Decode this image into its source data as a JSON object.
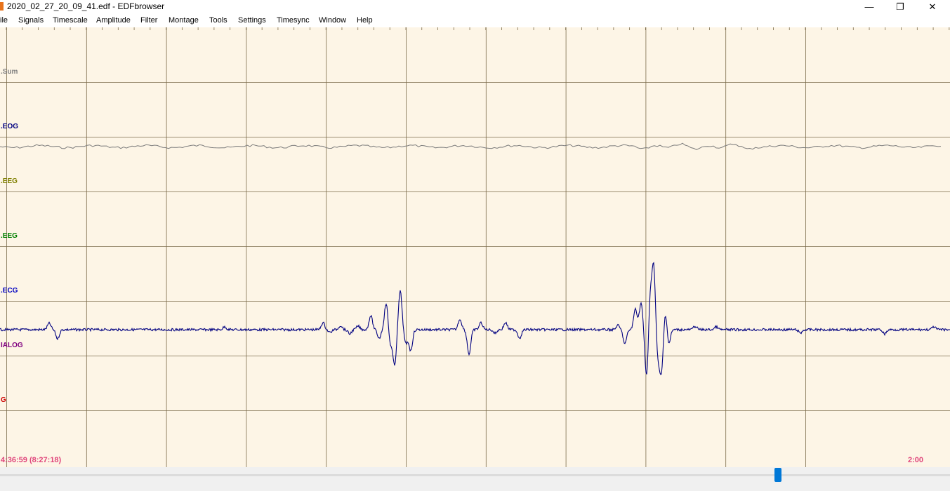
{
  "window": {
    "title": "2020_02_27_20_09_41.edf - EDFbrowser",
    "minimize_glyph": "—",
    "restore_glyph": "❐",
    "close_glyph": "✕"
  },
  "menu": {
    "items": [
      "ile",
      "Signals",
      "Timescale",
      "Amplitude",
      "Filter",
      "Montage",
      "Tools",
      "Settings",
      "Timesync",
      "Window",
      "Help"
    ]
  },
  "signals": [
    {
      "label": ".Sum",
      "color": "#808080"
    },
    {
      "label": ".EOG",
      "color": "#000080"
    },
    {
      "label": ".EEG",
      "color": "#808000"
    },
    {
      "label": ".EEG",
      "color": "#008000"
    },
    {
      "label": ".ECG",
      "color": "#0000c0"
    },
    {
      "label": "IALOG",
      "color": "#800080"
    },
    {
      "label": "G",
      "color": "#cc0000"
    }
  ],
  "footer": {
    "start_time": "4:36:59 (8:27:18)",
    "end_time": "2:00"
  },
  "colors": {
    "plot_background": "#fdf5e6",
    "grid": "#7a6a4a",
    "ecg_trace": "#000080",
    "eog_trace": "#7a7a7a",
    "time_text": "#e0457b",
    "scroll_handle": "#0078d7"
  }
}
